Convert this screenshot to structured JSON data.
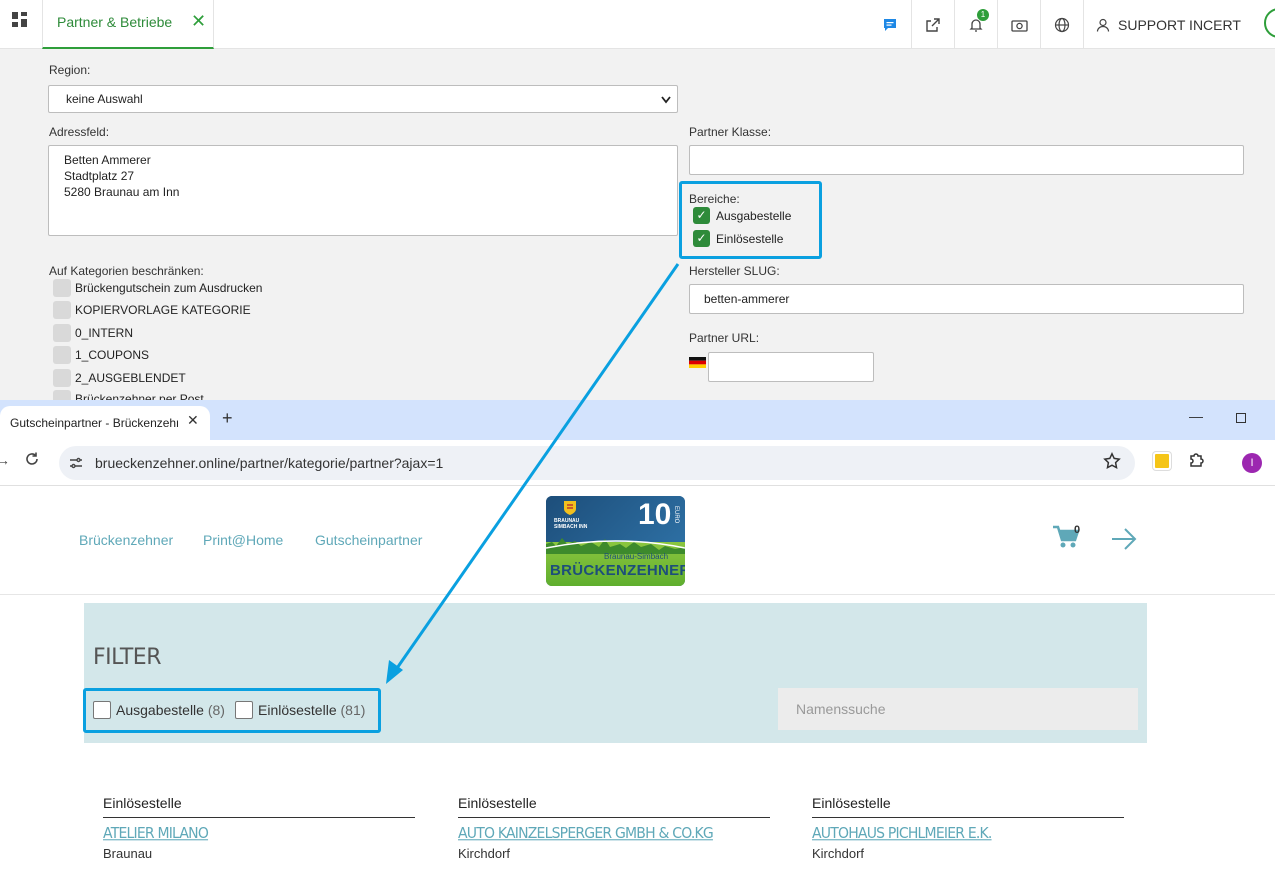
{
  "admin": {
    "tab_label": "Partner & Betriebe",
    "tab_close": "✕",
    "notification_count": "1",
    "support_label": "SUPPORT INCERT",
    "region_label": "Region:",
    "region_value": "keine Auswahl",
    "address_label": "Adressfeld:",
    "address_lines": [
      "Betten Ammerer",
      "Stadtplatz 27",
      "5280 Braunau am Inn"
    ],
    "categories_label": "Auf Kategorien beschränken:",
    "categories": [
      "Brückengutschein zum Ausdrucken",
      "KOPIERVORLAGE KATEGORIE",
      "0_INTERN",
      "1_COUPONS",
      "2_AUSGEBLENDET",
      "Brückenzehner per Post"
    ],
    "partner_class_label": "Partner Klasse:",
    "partner_class_value": "",
    "areas_label": "Bereiche:",
    "areas": [
      {
        "label": "Ausgabestelle",
        "checked": true
      },
      {
        "label": "Einlösestelle",
        "checked": true
      }
    ],
    "slug_label": "Hersteller SLUG:",
    "slug_value": "betten-ammerer",
    "url_label": "Partner URL:",
    "url_value": ""
  },
  "browser": {
    "tab_title": "Gutscheinpartner - Brückenzehner",
    "new_tab": "+",
    "url": "brueckenzehner.online/partner/kategorie/partner?ajax=1",
    "profile_initial": "I"
  },
  "site": {
    "nav": [
      "Brückenzehner",
      "Print@Home",
      "Gutscheinpartner"
    ],
    "logo": {
      "value": "10",
      "currency": "EURO",
      "city": "BRAUNAU SIMBACH INN",
      "subtitle": "Braunau-Simbach",
      "name": "BRÜCKENZEHNER"
    },
    "cart_count": "0",
    "filter": {
      "title": "FILTER",
      "options": [
        {
          "label": "Ausgabestelle",
          "count": "(8)"
        },
        {
          "label": "Einlösestelle",
          "count": "(81)"
        }
      ],
      "search_placeholder": "Namenssuche"
    },
    "partners": [
      {
        "type": "Einlösestelle",
        "name": "ATELIER MILANO",
        "city": "Braunau"
      },
      {
        "type": "Einlösestelle",
        "name": "AUTO KAINZELSPERGER GMBH & CO.KG",
        "city": "Kirchdorf"
      },
      {
        "type": "Einlösestelle",
        "name": "AUTOHAUS PICHLMEIER E.K.",
        "city": "Kirchdorf"
      }
    ]
  },
  "colors": {
    "admin_accent": "#2e9e3a",
    "highlight": "#0aa0e0",
    "site_link": "#5fa8b8",
    "filter_bg": "#d3e7ea"
  }
}
